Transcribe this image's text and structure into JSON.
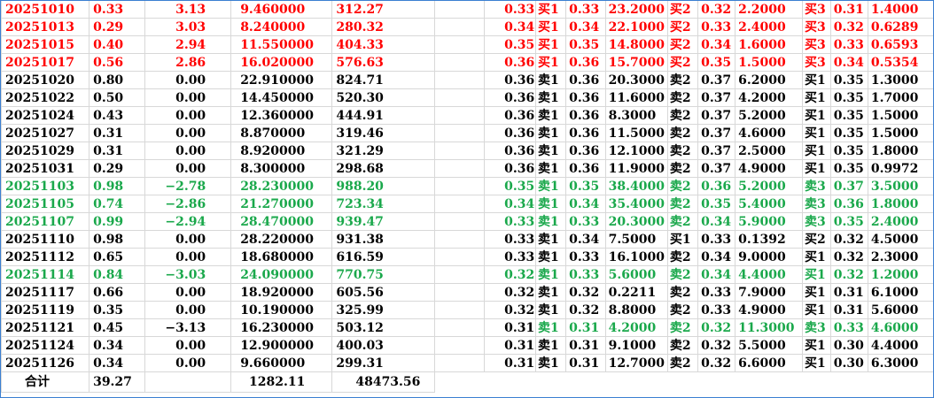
{
  "rows": [
    {
      "tone": "r",
      "date": "20251010",
      "chg": "0.33",
      "pct": "3.13",
      "price": "9.460000",
      "amount": "312.27",
      "cur": "0.33",
      "b1l": "买1",
      "b1p": "0.33",
      "b1v": "23.2000",
      "b2l": "买2",
      "b2p": "0.32",
      "b2v": "2.2000",
      "b3l": "买3",
      "b3p": "0.31",
      "b3v": "1.4000"
    },
    {
      "tone": "r",
      "date": "20251013",
      "chg": "0.29",
      "pct": "3.03",
      "price": "8.240000",
      "amount": "280.32",
      "cur": "0.34",
      "b1l": "买1",
      "b1p": "0.34",
      "b1v": "22.1000",
      "b2l": "买2",
      "b2p": "0.33",
      "b2v": "2.4000",
      "b3l": "买3",
      "b3p": "0.32",
      "b3v": "0.6289"
    },
    {
      "tone": "r",
      "date": "20251015",
      "chg": "0.40",
      "pct": "2.94",
      "price": "11.550000",
      "amount": "404.33",
      "cur": "0.35",
      "b1l": "买1",
      "b1p": "0.35",
      "b1v": "14.8000",
      "b2l": "买2",
      "b2p": "0.34",
      "b2v": "1.6000",
      "b3l": "买3",
      "b3p": "0.33",
      "b3v": "0.6593"
    },
    {
      "tone": "r",
      "date": "20251017",
      "chg": "0.56",
      "pct": "2.86",
      "price": "16.020000",
      "amount": "576.63",
      "cur": "0.36",
      "b1l": "买1",
      "b1p": "0.36",
      "b1v": "15.7000",
      "b2l": "买2",
      "b2p": "0.35",
      "b2v": "1.5000",
      "b3l": "买3",
      "b3p": "0.34",
      "b3v": "0.5354"
    },
    {
      "tone": "k",
      "date": "20251020",
      "chg": "0.80",
      "pct": "0.00",
      "price": "22.910000",
      "amount": "824.71",
      "cur": "0.36",
      "b1l": "卖1",
      "b1p": "0.36",
      "b1v": "20.3000",
      "b2l": "卖2",
      "b2p": "0.37",
      "b2v": "6.2000",
      "b3l": "买1",
      "b3p": "0.35",
      "b3v": "1.3000"
    },
    {
      "tone": "k",
      "date": "20251022",
      "chg": "0.50",
      "pct": "0.00",
      "price": "14.450000",
      "amount": "520.30",
      "cur": "0.36",
      "b1l": "卖1",
      "b1p": "0.36",
      "b1v": "11.6000",
      "b2l": "卖2",
      "b2p": "0.37",
      "b2v": "4.2000",
      "b3l": "买1",
      "b3p": "0.35",
      "b3v": "1.7000"
    },
    {
      "tone": "k",
      "date": "20251024",
      "chg": "0.43",
      "pct": "0.00",
      "price": "12.360000",
      "amount": "444.91",
      "cur": "0.36",
      "b1l": "卖1",
      "b1p": "0.36",
      "b1v": "8.3000",
      "b2l": "卖2",
      "b2p": "0.37",
      "b2v": "5.2000",
      "b3l": "买1",
      "b3p": "0.35",
      "b3v": "1.5000"
    },
    {
      "tone": "k",
      "date": "20251027",
      "chg": "0.31",
      "pct": "0.00",
      "price": "8.870000",
      "amount": "319.46",
      "cur": "0.36",
      "b1l": "卖1",
      "b1p": "0.36",
      "b1v": "11.5000",
      "b2l": "卖2",
      "b2p": "0.37",
      "b2v": "4.6000",
      "b3l": "买1",
      "b3p": "0.35",
      "b3v": "1.5000"
    },
    {
      "tone": "k",
      "date": "20251029",
      "chg": "0.31",
      "pct": "0.00",
      "price": "8.920000",
      "amount": "321.29",
      "cur": "0.36",
      "b1l": "卖1",
      "b1p": "0.36",
      "b1v": "12.1000",
      "b2l": "卖2",
      "b2p": "0.37",
      "b2v": "2.5000",
      "b3l": "买1",
      "b3p": "0.35",
      "b3v": "1.8000"
    },
    {
      "tone": "k",
      "date": "20251031",
      "chg": "0.29",
      "pct": "0.00",
      "price": "8.300000",
      "amount": "298.68",
      "cur": "0.36",
      "b1l": "卖1",
      "b1p": "0.36",
      "b1v": "11.9000",
      "b2l": "卖2",
      "b2p": "0.37",
      "b2v": "4.9000",
      "b3l": "买1",
      "b3p": "0.35",
      "b3v": "0.9972"
    },
    {
      "tone": "g",
      "date": "20251103",
      "chg": "0.98",
      "pct": "−2.78",
      "price": "28.230000",
      "amount": "988.20",
      "cur": "0.35",
      "b1l": "卖1",
      "b1p": "0.35",
      "b1v": "38.4000",
      "b2l": "卖2",
      "b2p": "0.36",
      "b2v": "5.2000",
      "b3l": "卖3",
      "b3p": "0.37",
      "b3v": "3.5000"
    },
    {
      "tone": "g",
      "date": "20251105",
      "chg": "0.74",
      "pct": "−2.86",
      "price": "21.270000",
      "amount": "723.34",
      "cur": "0.34",
      "b1l": "卖1",
      "b1p": "0.34",
      "b1v": "35.4000",
      "b2l": "卖2",
      "b2p": "0.35",
      "b2v": "5.4000",
      "b3l": "卖3",
      "b3p": "0.36",
      "b3v": "1.8000"
    },
    {
      "tone": "g",
      "date": "20251107",
      "chg": "0.99",
      "pct": "−2.94",
      "price": "28.470000",
      "amount": "939.47",
      "cur": "0.33",
      "b1l": "卖1",
      "b1p": "0.33",
      "b1v": "20.3000",
      "b2l": "卖2",
      "b2p": "0.34",
      "b2v": "5.9000",
      "b3l": "卖3",
      "b3p": "0.35",
      "b3v": "2.4000"
    },
    {
      "tone": "k",
      "date": "20251110",
      "chg": "0.98",
      "pct": "0.00",
      "price": "28.220000",
      "amount": "931.38",
      "cur": "0.33",
      "b1l": "卖1",
      "b1p": "0.34",
      "b1v": "7.5000",
      "b2l": "买1",
      "b2p": "0.33",
      "b2v": "0.1392",
      "b3l": "买2",
      "b3p": "0.32",
      "b3v": "4.5000"
    },
    {
      "tone": "k",
      "date": "20251112",
      "chg": "0.65",
      "pct": "0.00",
      "price": "18.680000",
      "amount": "616.59",
      "cur": "0.33",
      "b1l": "卖1",
      "b1p": "0.33",
      "b1v": "16.1000",
      "b2l": "卖2",
      "b2p": "0.34",
      "b2v": "9.0000",
      "b3l": "买1",
      "b3p": "0.32",
      "b3v": "2.3000"
    },
    {
      "tone": "g",
      "date": "20251114",
      "chg": "0.84",
      "pct": "−3.03",
      "price": "24.090000",
      "amount": "770.75",
      "cur": "0.32",
      "b1l": "卖1",
      "b1p": "0.33",
      "b1v": "5.6000",
      "b2l": "卖2",
      "b2p": "0.34",
      "b2v": "4.4000",
      "b3l": "买1",
      "b3p": "0.32",
      "b3v": "1.2000"
    },
    {
      "tone": "k",
      "date": "20251117",
      "chg": "0.66",
      "pct": "0.00",
      "price": "18.920000",
      "amount": "605.56",
      "cur": "0.32",
      "b1l": "卖1",
      "b1p": "0.32",
      "b1v": "0.2211",
      "b2l": "卖2",
      "b2p": "0.33",
      "b2v": "7.9000",
      "b3l": "买1",
      "b3p": "0.31",
      "b3v": "6.1000"
    },
    {
      "tone": "k",
      "date": "20251119",
      "chg": "0.35",
      "pct": "0.00",
      "price": "10.190000",
      "amount": "325.99",
      "cur": "0.32",
      "b1l": "卖1",
      "b1p": "0.32",
      "b1v": "8.8000",
      "b2l": "卖2",
      "b2p": "0.33",
      "b2v": "4.9000",
      "b3l": "买1",
      "b3p": "0.31",
      "b3v": "5.6000"
    },
    {
      "tone": "k",
      "date": "20251121",
      "chg": "0.45",
      "pct": "−3.13",
      "price": "16.230000",
      "amount": "503.12",
      "cur": "0.31",
      "b1l": "卖1",
      "b1p": "0.31",
      "b1v": "4.2000",
      "b2l": "卖2",
      "b2p": "0.32",
      "b2v": "11.3000",
      "b3l": "卖3",
      "b3p": "0.33",
      "b3v": "4.6000",
      "partial": true
    },
    {
      "tone": "k",
      "date": "20251124",
      "chg": "0.34",
      "pct": "0.00",
      "price": "12.900000",
      "amount": "400.03",
      "cur": "0.31",
      "b1l": "卖1",
      "b1p": "0.31",
      "b1v": "9.1000",
      "b2l": "卖2",
      "b2p": "0.32",
      "b2v": "5.5000",
      "b3l": "买1",
      "b3p": "0.30",
      "b3v": "4.4000"
    },
    {
      "tone": "k",
      "date": "20251126",
      "chg": "0.34",
      "pct": "0.00",
      "price": "9.660000",
      "amount": "299.31",
      "cur": "0.31",
      "b1l": "卖1",
      "b1p": "0.31",
      "b1v": "12.7000",
      "b2l": "卖2",
      "b2p": "0.32",
      "b2v": "6.6000",
      "b3l": "买1",
      "b3p": "0.30",
      "b3v": "6.3000"
    }
  ],
  "total": {
    "label": "合计",
    "chg_sum": "39.27",
    "price_sum": "1282.11",
    "amount_sum": "48473.56"
  },
  "colors": {
    "up": "#ff0000",
    "down": "#1aa84b",
    "flat": "#000000",
    "frame": "#3b7fd1"
  }
}
